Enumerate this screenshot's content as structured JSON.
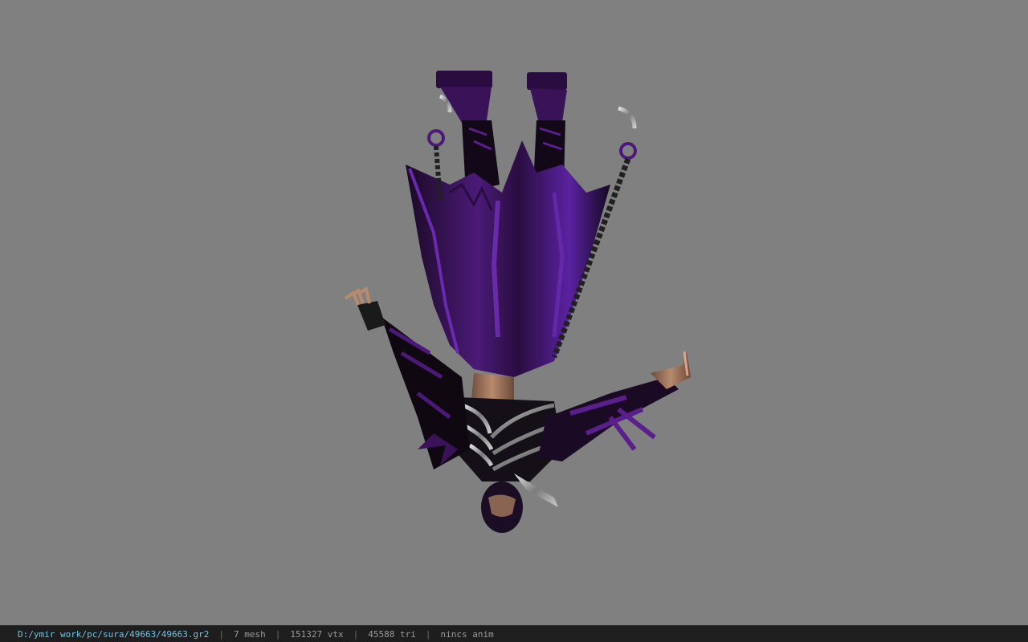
{
  "viewer": {
    "background_color": "#808080",
    "model_icon": "inverted-character-model"
  },
  "status": {
    "file_path": "D:/ymir work/pc/sura/49663/49663.gr2",
    "separator": "|",
    "mesh_count": "7 mesh",
    "vertex_count": "151327 vtx",
    "triangle_count": "45588 tri",
    "animation": "nincs anim"
  }
}
